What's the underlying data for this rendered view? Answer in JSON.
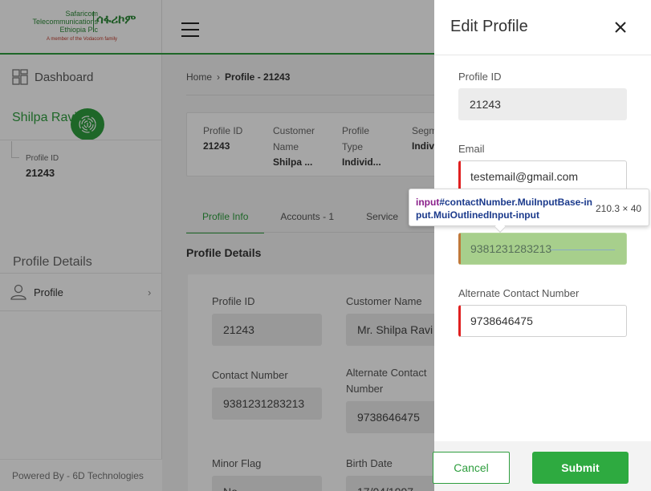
{
  "brand": {
    "line1": "Safaricom",
    "line2": "Telecommunications",
    "line3": "Ethiopia Plc",
    "amharic": "ሳፋሪኮም",
    "tagline": "A member of the Vodacom family"
  },
  "sidebar": {
    "dashboard_label": "Dashboard",
    "user_name": "Shilpa Ravi",
    "profile_id_label": "Profile ID",
    "profile_id_value": "21243",
    "section_title": "Profile Details",
    "profile_item_label": "Profile",
    "footer": "Powered By - 6D Technologies"
  },
  "breadcrumb": {
    "home": "Home",
    "current": "Profile - 21243"
  },
  "summary": {
    "profile_id_label": "Profile ID",
    "profile_id_value": "21243",
    "customer_name_label": "Customer Name",
    "customer_name_value": "Shilpa ...",
    "profile_type_label": "Profile Type",
    "profile_type_value": "Individ...",
    "segment_label": "Segm",
    "segment_value": "Indiv"
  },
  "tabs": {
    "profile_info": "Profile Info",
    "accounts": "Accounts - 1",
    "services": "Service"
  },
  "details": {
    "title": "Profile Details",
    "profile_id_label": "Profile ID",
    "profile_id_value": "21243",
    "customer_name_label": "Customer Name",
    "customer_name_value": "Mr. Shilpa Ravi",
    "contact_label": "Contact Number",
    "contact_value": "9381231283213",
    "alt_contact_label_1": "Alternate Contact",
    "alt_contact_label_2": "Number",
    "alt_contact_value": "9738646475",
    "minor_flag_label": "Minor Flag",
    "minor_flag_value": "No",
    "birth_date_label": "Birth Date",
    "birth_date_value": "17/04/1997"
  },
  "drawer": {
    "title": "Edit Profile",
    "profile_id_label": "Profile ID",
    "profile_id_value": "21243",
    "email_label": "Email",
    "email_value": "testemail@gmail.com",
    "contact_value": "9381231283213",
    "alt_contact_label": "Alternate Contact Number",
    "alt_contact_value": "9738646475",
    "cancel_label": "Cancel",
    "submit_label": "Submit"
  },
  "inspector_tooltip": {
    "tag": "input",
    "selector": "#contactNumber.MuiInputBase-input.MuiOutlinedInput-input",
    "dimensions": "210.3 × 40"
  },
  "colors": {
    "brand_green": "#2e9e3e",
    "error_red": "#e02020",
    "highlight_green": "#a7cf8c"
  }
}
